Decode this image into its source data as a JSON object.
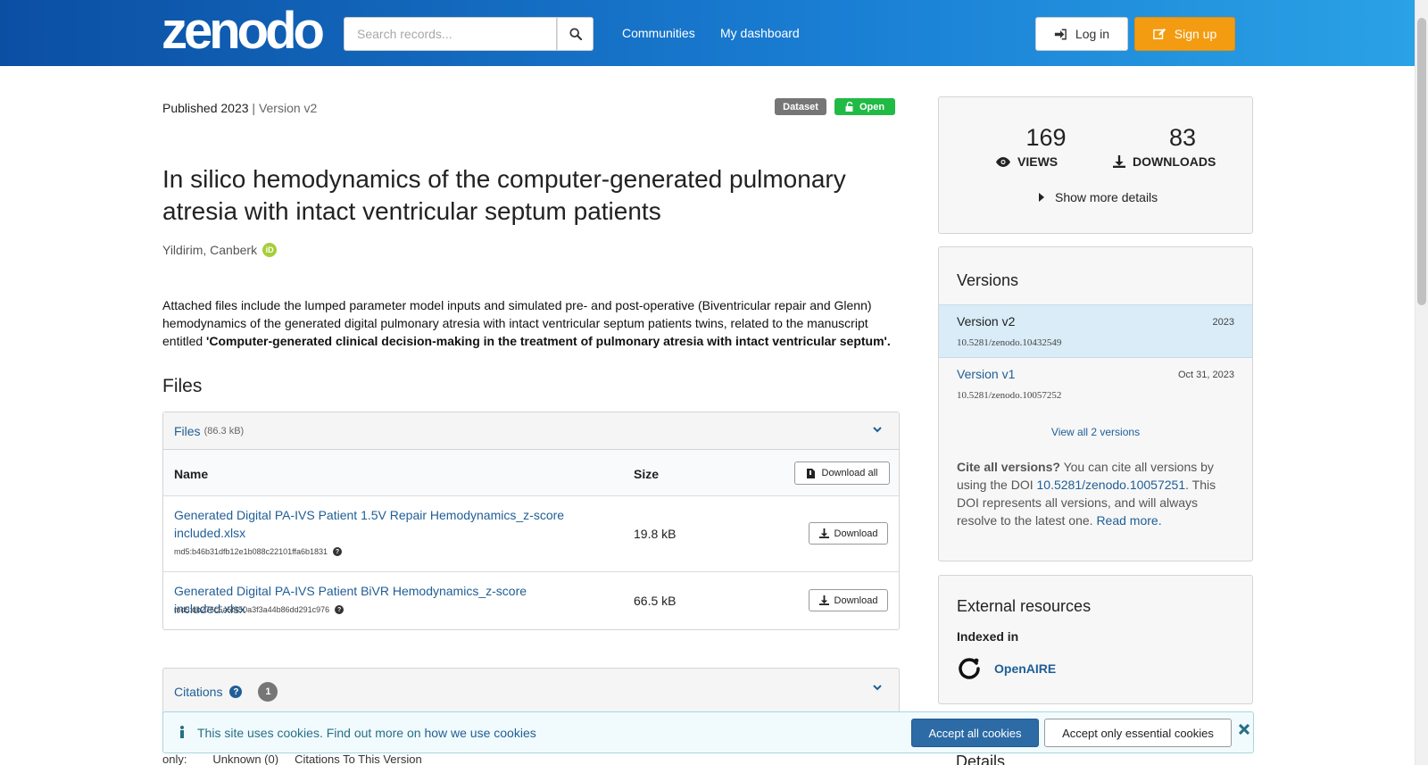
{
  "header": {
    "logo_text": "zenodo",
    "search_placeholder": "Search records...",
    "nav": [
      "Communities",
      "My dashboard"
    ],
    "login_label": "Log in",
    "signup_label": "Sign up"
  },
  "record": {
    "published": "Published 2023",
    "version": "Version v2",
    "badge_type": "Dataset",
    "badge_access": "Open",
    "title": "In silico hemodynamics of the computer-generated pulmonary atresia with intact ventricular septum patients",
    "author": "Yildirim, Canberk",
    "description_plain": "Attached files include the lumped parameter model inputs and simulated pre- and post-operative (Biventricular repair and Glenn) hemodynamics of the generated digital pulmonary atresia with intact ventricular septum patients twins, related to the manuscript entitled ",
    "description_bold": "'Computer-generated clinical decision-making in the treatment of pulmonary atresia with intact ventricular septum'."
  },
  "files": {
    "heading": "Files",
    "panel_label": "Files",
    "panel_size": "(86.3 kB)",
    "col_name": "Name",
    "col_size": "Size",
    "download_all_label": "Download all",
    "download_label": "Download",
    "rows": [
      {
        "name": "Generated Digital PA-IVS Patient 1.5V Repair Hemodynamics_z-score included.xlsx",
        "md5": "md5:b46b31dfb12e1b088c22101ffa6b1831",
        "size": "19.8 kB"
      },
      {
        "name": "Generated Digital PA-IVS Patient BiVR Hemodynamics_z-score included.xlsx",
        "md5": "md5:db276c5a5f450a3f3a44b86dd291c976",
        "size": "66.5 kB"
      }
    ]
  },
  "citations": {
    "label": "Citations",
    "count": "1",
    "peek_text": "only:        Unknown (0)     Citations To This Version"
  },
  "stats": {
    "views": "169",
    "views_label": "VIEWS",
    "downloads": "83",
    "downloads_label": "DOWNLOADS",
    "more_details": "Show more details"
  },
  "versions": {
    "heading": "Versions",
    "items": [
      {
        "name": "Version v2",
        "date": "2023",
        "doi": "10.5281/zenodo.10432549"
      },
      {
        "name": "Version v1",
        "date": "Oct 31, 2023",
        "doi": "10.5281/zenodo.10057252"
      }
    ],
    "view_all": "View all 2 versions",
    "cite_bold": "Cite all versions?",
    "cite_pre": " You can cite all versions by using the DOI ",
    "cite_doi": "10.5281/zenodo.10057251",
    "cite_post": ". This DOI represents all versions, and will always resolve to the latest one. ",
    "read_more": "Read more."
  },
  "external": {
    "heading": "External resources",
    "indexed_in": "Indexed in",
    "resource": "OpenAIRE"
  },
  "details_heading": "Details",
  "cookie": {
    "message": "This site uses cookies. Find out more on ",
    "link": "how we use cookies",
    "accept_all": "Accept all cookies",
    "accept_essential": "Accept only essential cookies"
  },
  "colors": {
    "header_start": "#0b4fa3",
    "header_end": "#2aa2e6",
    "signup": "#f39c12",
    "open_badge": "#21ba45",
    "link": "#1f5e96"
  }
}
